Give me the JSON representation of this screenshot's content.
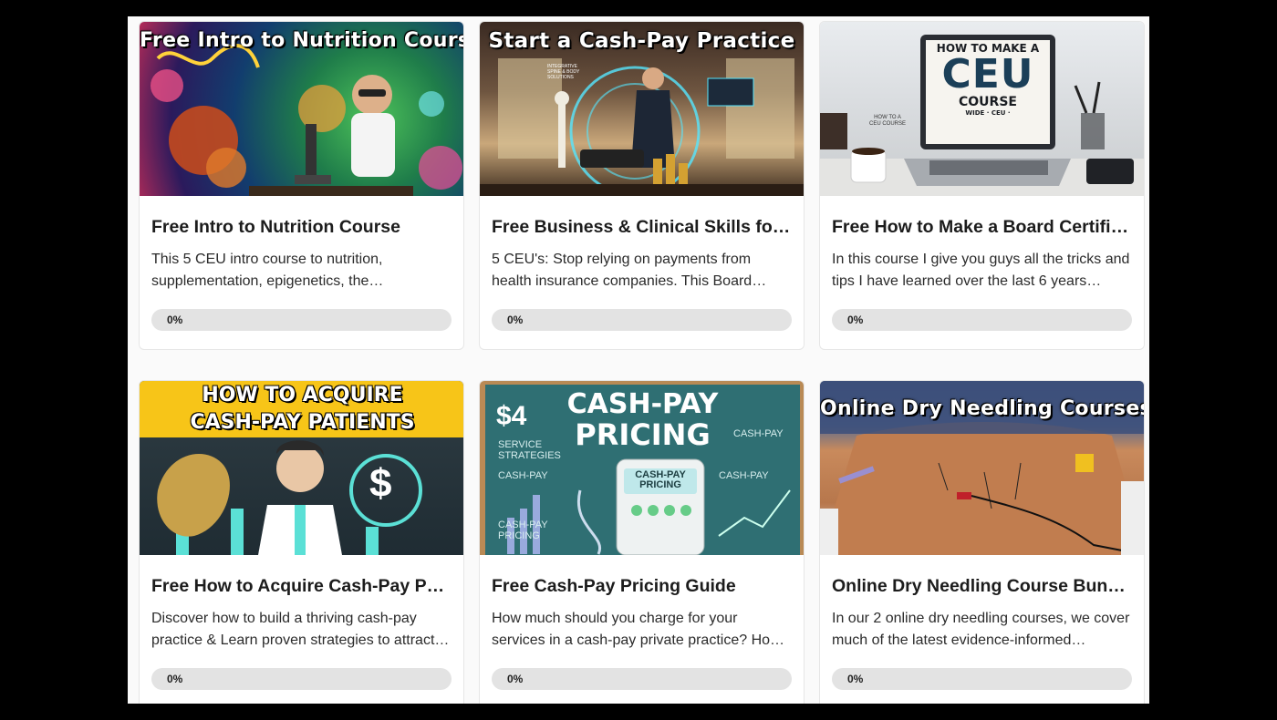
{
  "courses": [
    {
      "banner": "Free Intro to Nutrition Course",
      "title": "Free Intro to Nutrition Course",
      "description": "This 5 CEU intro course to nutrition, supplementation, epigenetics, the…",
      "progress_label": "0%",
      "progress": 0
    },
    {
      "banner": "Start a Cash-Pay Practice",
      "title": "Free Business & Clinical Skills for …",
      "description": "5 CEU's: Stop relying on payments from health insurance companies. This Board…",
      "progress_label": "0%",
      "progress": 0
    },
    {
      "banner": "HOW TO MAKE A CEU COURSE",
      "title": "Free How to Make a Board Certifie…",
      "description": "In this course I give you guys all the tricks and tips I have learned over the last 6 years…",
      "progress_label": "0%",
      "progress": 0
    },
    {
      "banner": "HOW TO ACQUIRE CASH-PAY PATIENTS",
      "title": "Free How to Acquire Cash-Pay Pa…",
      "description": "Discover how to build a thriving cash-pay practice & Learn proven strategies to attract…",
      "progress_label": "0%",
      "progress": 0
    },
    {
      "banner": "CASH-PAY PRICING",
      "title": "Free Cash-Pay Pricing Guide",
      "description": "How much should you charge for your services in a cash-pay private practice? Ho…",
      "progress_label": "0%",
      "progress": 0
    },
    {
      "banner": "Online Dry Needling Courses",
      "title": "Online Dry Needling Course Bundl…",
      "description": "In our 2 online dry needling courses, we cover much of the latest evidence-informed…",
      "progress_label": "0%",
      "progress": 0
    }
  ],
  "images": {
    "ceu_laptop": {
      "line1": "HOW TO MAKE A",
      "line2": "CEU",
      "line3": "COURSE",
      "line4": "WIDE · CEU ·"
    },
    "ceu_mug": "HOW TO A CEU COURSE",
    "acquire": {
      "line1": "HOW TO ACQUIRE",
      "line2": "CASH-PAY PATIENTS",
      "dollar": "$"
    },
    "pricing": {
      "line1": "CASH-PAY",
      "line2": "PRICING",
      "calc": "CASH-PAY PRICING",
      "side1": "SERVICE STRATEGIES",
      "side2": "CASH-PAY",
      "side3": "CASH-PAY PRICING",
      "right1": "CASH-PAY",
      "right2": "CASH-PAY",
      "s4": "$4"
    },
    "cashpay_sign": "INTEGRATIVE SPINE & BODY SOLUTIONS"
  },
  "colors": {
    "progress_track": "#e3e3e3",
    "card_border": "#e6e6e6",
    "acquire_banner": "#f7c518",
    "pricing_board": "#2f6f73"
  }
}
